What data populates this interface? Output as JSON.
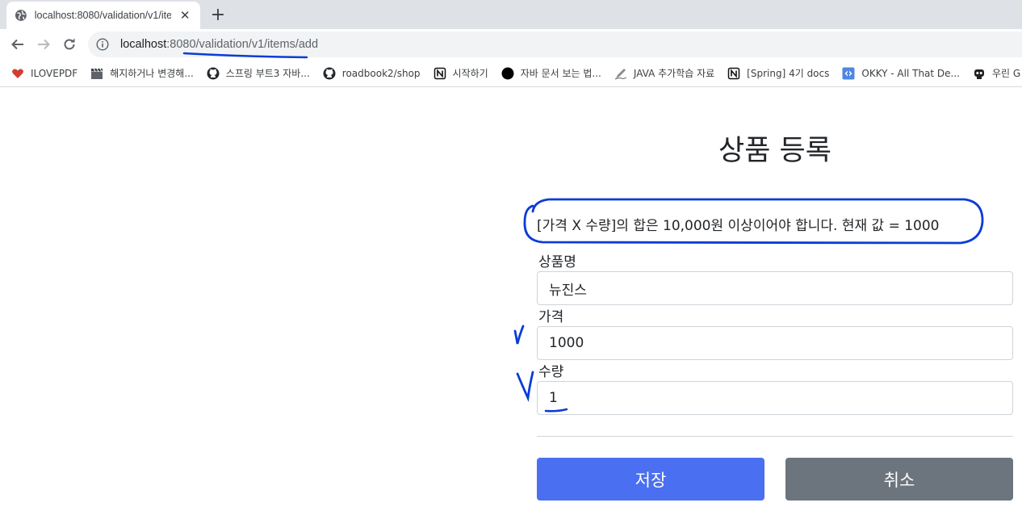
{
  "browser": {
    "tab_title": "localhost:8080/validation/v1/ite",
    "url_host": "localhost",
    "url_rest": ":8080/validation/v1/items/add",
    "bookmarks": [
      {
        "label": "ILOVEPDF",
        "icon": "heart-icon"
      },
      {
        "label": "해지하거나 변경해...",
        "icon": "clapperboard-icon"
      },
      {
        "label": "스프링 부트3 자바...",
        "icon": "github-icon"
      },
      {
        "label": "roadbook2/shop",
        "icon": "github-icon"
      },
      {
        "label": "시작하기",
        "icon": "notion-icon"
      },
      {
        "label": "자바 문서 보는 법...",
        "icon": "circle-icon"
      },
      {
        "label": "JAVA 추가학습 자료",
        "icon": "pen-icon"
      },
      {
        "label": "[Spring] 4기 docs",
        "icon": "notion-icon"
      },
      {
        "label": "OKKY - All That De...",
        "icon": "okky-icon"
      },
      {
        "label": "우린 G",
        "icon": "robot-icon"
      }
    ]
  },
  "page": {
    "title": "상품 등록",
    "global_error": "[가격 X 수량]의 합은 10,000원 이상이어야 합니다. 현재 값 = 1000",
    "fields": {
      "item_name": {
        "label": "상품명",
        "value": "뉴진스"
      },
      "price": {
        "label": "가격",
        "value": "1000"
      },
      "quantity": {
        "label": "수량",
        "value": "1"
      }
    },
    "buttons": {
      "save": "저장",
      "cancel": "취소"
    }
  },
  "colors": {
    "save_button": "#4a6ff0",
    "cancel_button": "#6c757d",
    "annotation_ink": "#0a3cd6"
  }
}
